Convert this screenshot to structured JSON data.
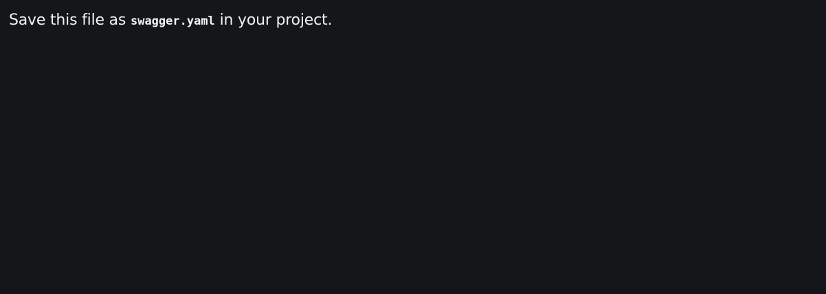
{
  "message": {
    "prefix": "Save this file as ",
    "filename": "swagger.yaml",
    "suffix": " in your project."
  },
  "colors": {
    "background": "#15161a",
    "text": "#f2f3f5"
  }
}
